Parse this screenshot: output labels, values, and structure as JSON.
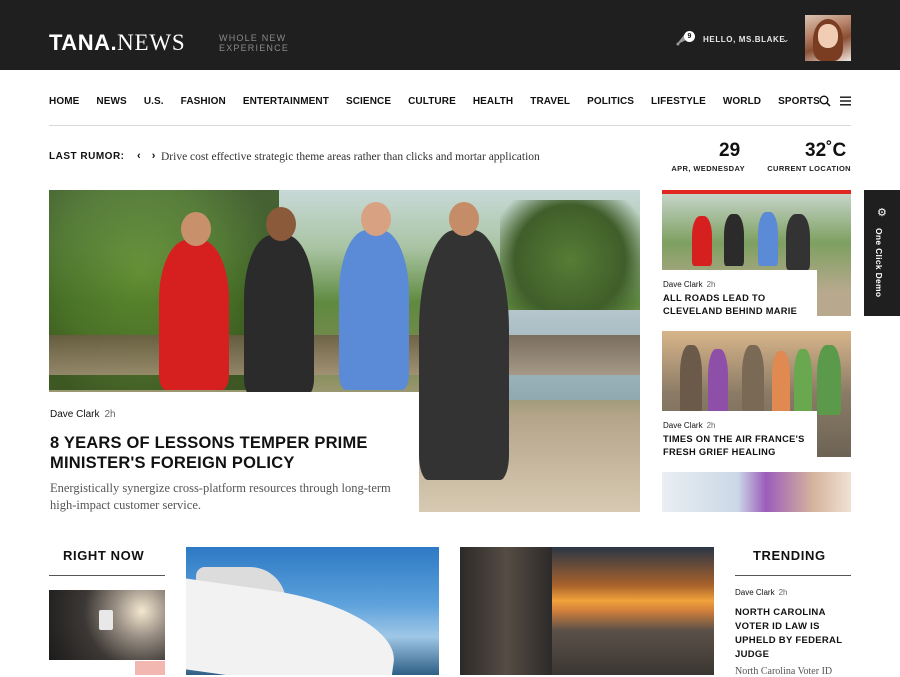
{
  "header": {
    "logo_main": "TANA.",
    "logo_sub": "NEWS",
    "tagline": "WHOLE NEW EXPERIENCE",
    "notification_count": "9",
    "greeting": "HELLO, MS.BLAKE",
    "colors": {
      "bar": "#1f1f1f",
      "accent": "#e0261e"
    }
  },
  "nav": {
    "items": [
      "HOME",
      "NEWS",
      "U.S.",
      "FASHION",
      "ENTERTAINMENT",
      "SCIENCE",
      "CULTURE",
      "HEALTH",
      "TRAVEL",
      "POLITICS",
      "LIFESTYLE",
      "WORLD",
      "SPORTS"
    ]
  },
  "rumor": {
    "label": "LAST RUMOR:",
    "arrows": "‹ ›",
    "text": "Drive cost effective strategic theme areas rather than clicks and mortar application"
  },
  "weather": {
    "date_num": "29",
    "date_label": "APR, WEDNESDAY",
    "temp": "32˚C",
    "temp_label": "CURRENT LOCATION"
  },
  "hero": {
    "author": "Dave Clark",
    "time": "2h",
    "title": "8 YEARS OF LESSONS TEMPER PRIME MINISTER'S FOREIGN POLICY",
    "excerpt": "Energistically synergize cross-platform resources through long-term high-impact customer service."
  },
  "side_stories": [
    {
      "author": "Dave Clark",
      "time": "2h",
      "title": "ALL ROADS LEAD TO CLEVELAND BEHIND MARIE"
    },
    {
      "author": "Dave Clark",
      "time": "2h",
      "title": "TIMES ON THE AIR FRANCE'S FRESH GRIEF HEALING"
    }
  ],
  "demo_tab": {
    "label": "One Click Demo"
  },
  "right_now": {
    "title": "RIGHT NOW"
  },
  "trending": {
    "title": "TRENDING",
    "author": "Dave Clark",
    "time": "2h",
    "story_title": "NORTH CAROLINA VOTER ID LAW IS UPHELD BY FEDERAL JUDGE",
    "excerpt": "North Carolina Voter ID"
  }
}
